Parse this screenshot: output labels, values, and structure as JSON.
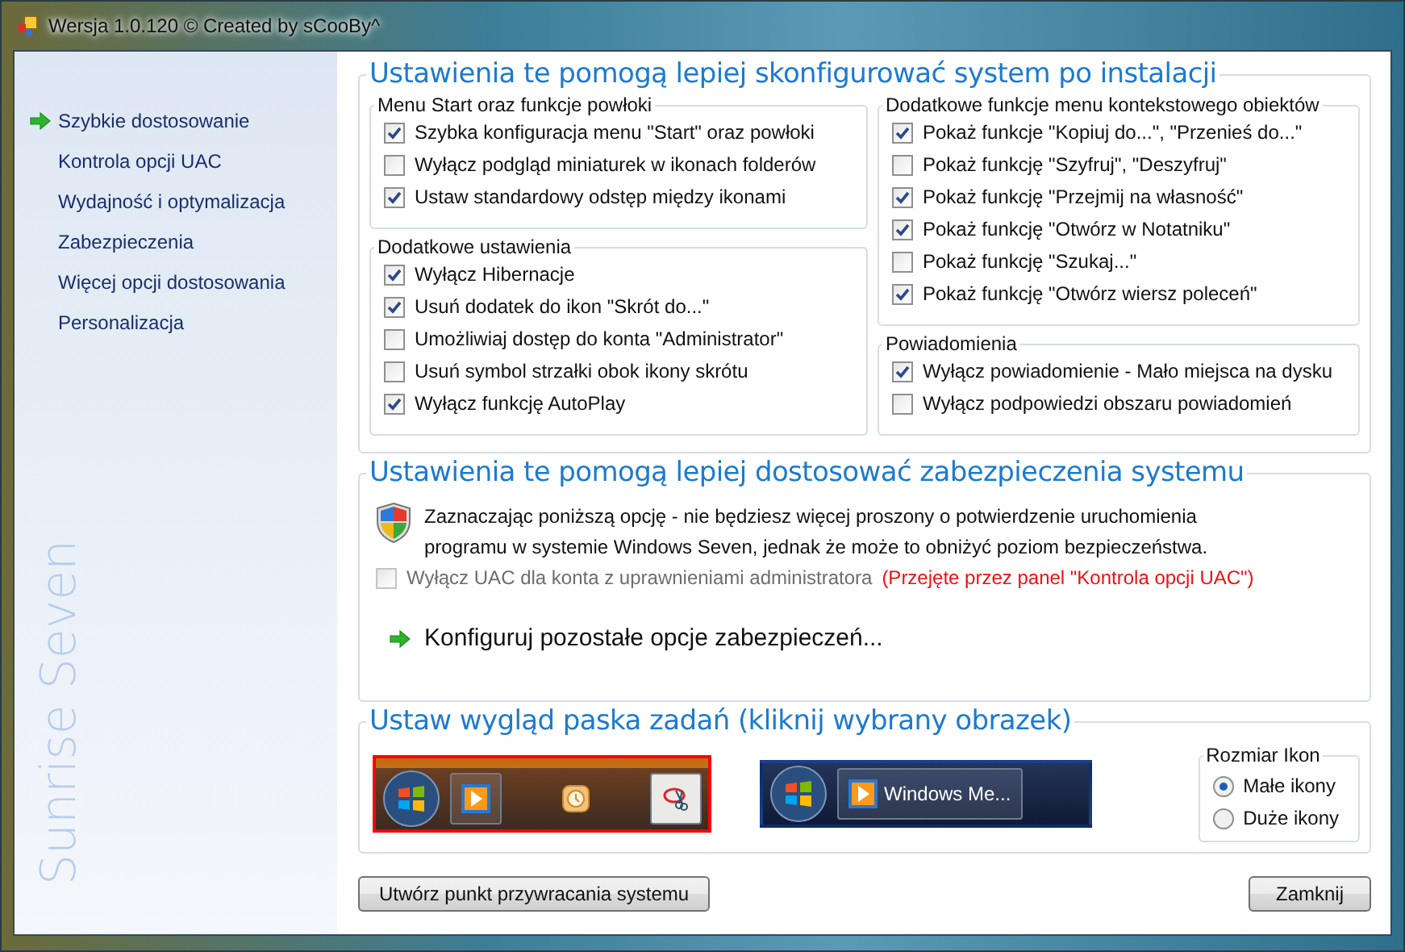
{
  "window": {
    "title": "Wersja 1.0.120 © Created by sCooBy^"
  },
  "sidebar": {
    "items": [
      {
        "label": "Szybkie dostosowanie",
        "selected": true
      },
      {
        "label": "Kontrola opcji UAC",
        "selected": false
      },
      {
        "label": "Wydajność i optymalizacja",
        "selected": false
      },
      {
        "label": "Zabezpieczenia",
        "selected": false
      },
      {
        "label": "Więcej opcji dostosowania",
        "selected": false
      },
      {
        "label": "Personalizacja",
        "selected": false
      }
    ],
    "brand": "Sunrise Seven"
  },
  "setup_section": {
    "title": "Ustawienia te pomogą lepiej skonfigurować system po instalacji",
    "left_groups": [
      {
        "title": "Menu Start oraz funkcje powłoki",
        "options": [
          {
            "label": "Szybka konfiguracja menu \"Start\" oraz powłoki",
            "checked": true
          },
          {
            "label": "Wyłącz podgląd miniaturek w ikonach folderów",
            "checked": false
          },
          {
            "label": "Ustaw standardowy odstęp między ikonami",
            "checked": true
          }
        ]
      },
      {
        "title": "Dodatkowe ustawienia",
        "options": [
          {
            "label": "Wyłącz Hibernacje",
            "checked": true
          },
          {
            "label": "Usuń dodatek do ikon \"Skrót do...\"",
            "checked": true
          },
          {
            "label": "Umożliwiaj dostęp do konta \"Administrator\"",
            "checked": false
          },
          {
            "label": "Usuń symbol strzałki obok ikony skrótu",
            "checked": false
          },
          {
            "label": "Wyłącz funkcję AutoPlay",
            "checked": true
          }
        ]
      }
    ],
    "right_groups": [
      {
        "title": "Dodatkowe funkcje menu kontekstowego obiektów",
        "options": [
          {
            "label": "Pokaż funkcje \"Kopiuj do...\", \"Przenieś do...\"",
            "checked": true
          },
          {
            "label": "Pokaż funkcję \"Szyfruj\", \"Deszyfruj\"",
            "checked": false
          },
          {
            "label": "Pokaż funkcję \"Przejmij na własność\"",
            "checked": true
          },
          {
            "label": "Pokaż funkcję \"Otwórz w Notatniku\"",
            "checked": true
          },
          {
            "label": "Pokaż funkcję \"Szukaj...\"",
            "checked": false
          },
          {
            "label": "Pokaż funkcję \"Otwórz wiersz poleceń\"",
            "checked": true
          }
        ]
      },
      {
        "title": "Powiadomienia",
        "options": [
          {
            "label": "Wyłącz powiadomienie - Mało miejsca na dysku",
            "checked": true
          },
          {
            "label": "Wyłącz podpowiedzi obszaru powiadomień",
            "checked": false
          }
        ]
      }
    ]
  },
  "security_section": {
    "title": "Ustawienia te pomogą lepiej dostosować zabezpieczenia systemu",
    "description": "Zaznaczając poniższą opcję - nie będziesz więcej proszony o potwierdzenie uruchomienia programu w systemie Windows Seven, jednak że może to obniżyć poziom bezpieczeństwa.",
    "uac_option": {
      "label": "Wyłącz UAC dla konta z uprawnieniami administratora",
      "checked": false,
      "disabled": true
    },
    "uac_note": "(Przejęte przez panel \"Kontrola opcji UAC\")",
    "link": "Konfiguruj pozostałe opcje zabezpieczeń..."
  },
  "taskbar_section": {
    "title": "Ustaw wygląd paska zadań (kliknij wybrany obrazek)",
    "previews": [
      {
        "kind": "icons",
        "selected": true
      },
      {
        "kind": "labels",
        "selected": false,
        "button_label": "Windows Me..."
      }
    ],
    "icon_size": {
      "title": "Rozmiar Ikon",
      "options": [
        {
          "label": "Małe ikony",
          "selected": true
        },
        {
          "label": "Duże ikony",
          "selected": false
        }
      ]
    }
  },
  "buttons": [
    {
      "label": "Utwórz punkt przywracania systemu"
    },
    {
      "label": "Zamknij"
    }
  ]
}
